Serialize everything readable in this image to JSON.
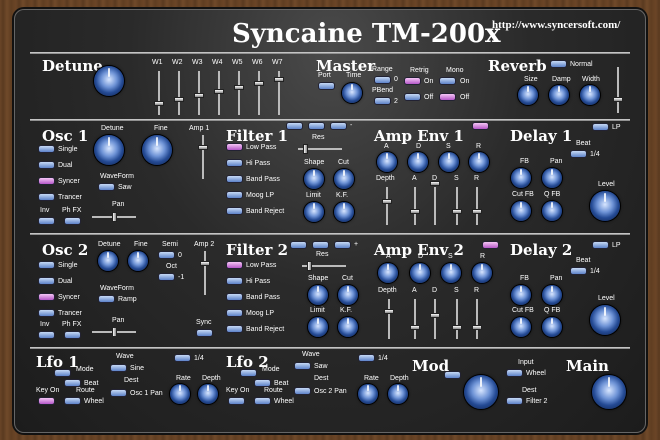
{
  "title": "Syncaine TM-200x",
  "url": "http://www.syncersoft.com/",
  "colors": {
    "button_blue": "#5d82c8",
    "button_active": "#b557c8",
    "knob": "#244a94"
  },
  "detune": {
    "title": "Detune",
    "sliders": [
      "W1",
      "W2",
      "W3",
      "W4",
      "W5",
      "W6",
      "W7"
    ]
  },
  "master": {
    "title": "Master",
    "port": "Port",
    "time": "Time",
    "range": "Range",
    "range_0": "0",
    "pbend": "PBend",
    "pbend_2": "2",
    "retrig": "Retrig",
    "retrig_on": "On",
    "retrig_off": "Off",
    "mono": "Mono",
    "mono_on": "On",
    "mono_off": "Off"
  },
  "reverb": {
    "title": "Reverb",
    "normal": "Normal",
    "size": "Size",
    "damp": "Damp",
    "width": "Width"
  },
  "osc1": {
    "title": "Osc 1",
    "detune": "Detune",
    "fine": "Fine",
    "amp": "Amp 1",
    "modes": [
      "Single",
      "Dual",
      "Syncer",
      "Trancer"
    ],
    "inv": "Inv",
    "phfx": "Ph FX",
    "waveform": "WaveForm",
    "wave": "Saw",
    "pan": "Pan"
  },
  "osc2": {
    "title": "Osc 2",
    "detune": "Detune",
    "fine": "Fine",
    "semi": "Semi",
    "semi_val": "0",
    "oct": "Oct",
    "oct_val": "-1",
    "amp": "Amp 2",
    "modes": [
      "Single",
      "Dual",
      "Syncer",
      "Trancer"
    ],
    "inv": "Inv",
    "phfx": "Ph FX",
    "waveform": "WaveForm",
    "wave": "Ramp",
    "pan": "Pan",
    "sync": "Sync"
  },
  "filter1": {
    "title": "Filter 1",
    "res": "Res",
    "minus": "-",
    "types": [
      "Low Pass",
      "Hi Pass",
      "Band Pass",
      "Moog LP",
      "Band Reject"
    ],
    "shape": "Shape",
    "cut": "Cut",
    "limit": "Limit",
    "kf": "K.F."
  },
  "filter2": {
    "title": "Filter 2",
    "res": "Res",
    "plus": "+",
    "types": [
      "Low Pass",
      "Hi Pass",
      "Band Pass",
      "Moog LP",
      "Band Reject"
    ],
    "shape": "Shape",
    "cut": "Cut",
    "limit": "Limit",
    "kf": "K.F."
  },
  "ampenv1": {
    "title": "Amp Env 1",
    "knobs": [
      "A",
      "D",
      "S",
      "R"
    ],
    "depth": "Depth",
    "sliders": [
      "A",
      "D",
      "S",
      "R"
    ]
  },
  "ampenv2": {
    "title": "Amp Env 2",
    "knobs": [
      "A",
      "D",
      "S",
      "R"
    ],
    "depth": "Depth",
    "sliders": [
      "A",
      "D",
      "S",
      "R"
    ]
  },
  "delay1": {
    "title": "Delay 1",
    "lp": "LP",
    "beat": "Beat",
    "beat_val": "1/4",
    "fb": "FB",
    "pan": "Pan",
    "cutfb": "Cut FB",
    "qfb": "Q FB",
    "level": "Level"
  },
  "delay2": {
    "title": "Delay 2",
    "lp": "LP",
    "beat": "Beat",
    "beat_val": "1/4",
    "fb": "FB",
    "pan": "Pan",
    "cutfb": "Cut FB",
    "qfb": "Q FB",
    "level": "Level"
  },
  "lfo1": {
    "title": "Lfo 1",
    "wave": "Wave",
    "wave_val": "Sine",
    "rate_div": "1/4",
    "mode": "Mode",
    "beat": "Beat",
    "dest": "Dest",
    "dest_val": "Osc 1 Pan",
    "keyon": "Key On",
    "route": "Route",
    "wheel": "Wheel",
    "rate": "Rate",
    "depth": "Depth"
  },
  "lfo2": {
    "title": "Lfo 2",
    "wave": "Wave",
    "wave_val": "Saw",
    "rate_div": "1/4",
    "mode": "Mode",
    "beat": "Beat",
    "dest": "Dest",
    "dest_val": "Osc 2 Pan",
    "keyon": "Key On",
    "route": "Route",
    "wheel": "Wheel",
    "rate": "Rate",
    "depth": "Depth"
  },
  "mod": {
    "title": "Mod",
    "input": "Input",
    "input_val": "Wheel",
    "dest": "Dest",
    "dest_val": "Filter 2"
  },
  "main": {
    "title": "Main"
  }
}
